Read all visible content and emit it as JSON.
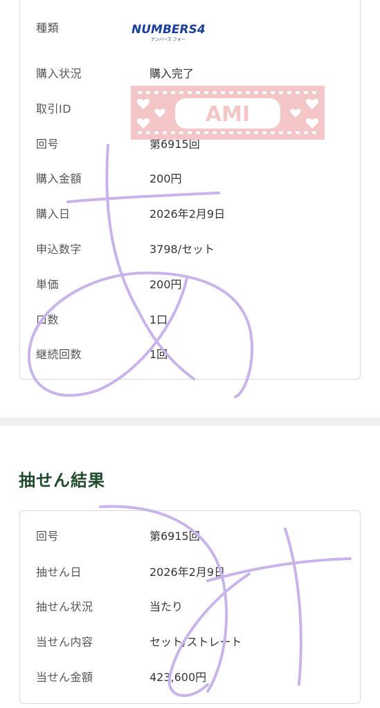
{
  "purchase": {
    "logo_text": "NUMBERS4",
    "logo_sub": "ナンバーズ フォー",
    "rows": [
      {
        "label": "種類",
        "value": ""
      },
      {
        "label": "購入状況",
        "value": "購入完了"
      },
      {
        "label": "取引ID",
        "value": ""
      },
      {
        "label": "回号",
        "value": "第6915回"
      },
      {
        "label": "購入金額",
        "value": "200円"
      },
      {
        "label": "購入日",
        "value": "2026年2月9日"
      },
      {
        "label": "申込数字",
        "value": "3798/セット"
      },
      {
        "label": "単価",
        "value": "200円"
      },
      {
        "label": "口数",
        "value": "1口"
      },
      {
        "label": "継続回数",
        "value": "1回"
      }
    ]
  },
  "sticker": {
    "text": "AMI"
  },
  "draw_result": {
    "title": "抽せん結果",
    "rows": [
      {
        "label": "回号",
        "value": "第6915回"
      },
      {
        "label": "抽せん日",
        "value": "2026年2月9日"
      },
      {
        "label": "抽せん状況",
        "value": "当たり"
      },
      {
        "label": "当せん内容",
        "value": "セット/ストレート"
      },
      {
        "label": "当せん金額",
        "value": "423,600円"
      }
    ]
  },
  "colors": {
    "title_green": "#1f4a2c",
    "scribble": "#c8b4ea",
    "sticker_pink": "#f5c6c8"
  }
}
